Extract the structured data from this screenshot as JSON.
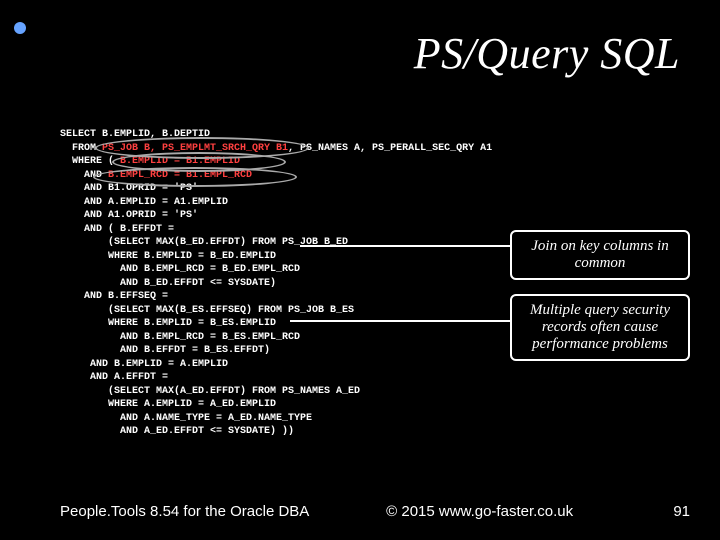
{
  "title": "PS/Query SQL",
  "sql": {
    "l1": "SELECT B.EMPLID, B.DEPTID",
    "l2a": "  FROM ",
    "l2b": "PS_JOB B, PS_EMPLMT_SRCH_QRY B1",
    "l2c": ", PS_NAMES A, PS_PERALL_SEC_QRY A1",
    "l3a": "  WHERE ( ",
    "l3b": "B.EMPLID = B1.EMPLID",
    "l4a": "    AND ",
    "l4b": "B.EMPL_RCD = B1.EMPL_RCD",
    "l5": "    AND B1.OPRID = 'PS'",
    "l6": "    AND A.EMPLID = A1.EMPLID",
    "l7": "    AND A1.OPRID = 'PS'",
    "l8": "    AND ( B.EFFDT =",
    "l9": "        (SELECT MAX(B_ED.EFFDT) FROM PS_JOB B_ED",
    "l10": "        WHERE B.EMPLID = B_ED.EMPLID",
    "l11": "          AND B.EMPL_RCD = B_ED.EMPL_RCD",
    "l12": "          AND B_ED.EFFDT <= SYSDATE)",
    "l13": "    AND B.EFFSEQ =",
    "l14": "        (SELECT MAX(B_ES.EFFSEQ) FROM PS_JOB B_ES",
    "l15": "        WHERE B.EMPLID = B_ES.EMPLID",
    "l16": "          AND B.EMPL_RCD = B_ES.EMPL_RCD",
    "l17": "          AND B.EFFDT = B_ES.EFFDT)",
    "l18": "     AND B.EMPLID = A.EMPLID",
    "l19": "     AND A.EFFDT =",
    "l20": "        (SELECT MAX(A_ED.EFFDT) FROM PS_NAMES A_ED",
    "l21": "        WHERE A.EMPLID = A_ED.EMPLID",
    "l22": "          AND A.NAME_TYPE = A_ED.NAME_TYPE",
    "l23": "          AND A_ED.EFFDT <= SYSDATE) ))"
  },
  "callouts": {
    "c1": "Join on key columns in common",
    "c2": "Multiple query security records often cause performance problems"
  },
  "footer": {
    "left": "People.Tools 8.54 for the Oracle DBA",
    "mid": "© 2015 www.go-faster.co.uk",
    "right": "91"
  }
}
